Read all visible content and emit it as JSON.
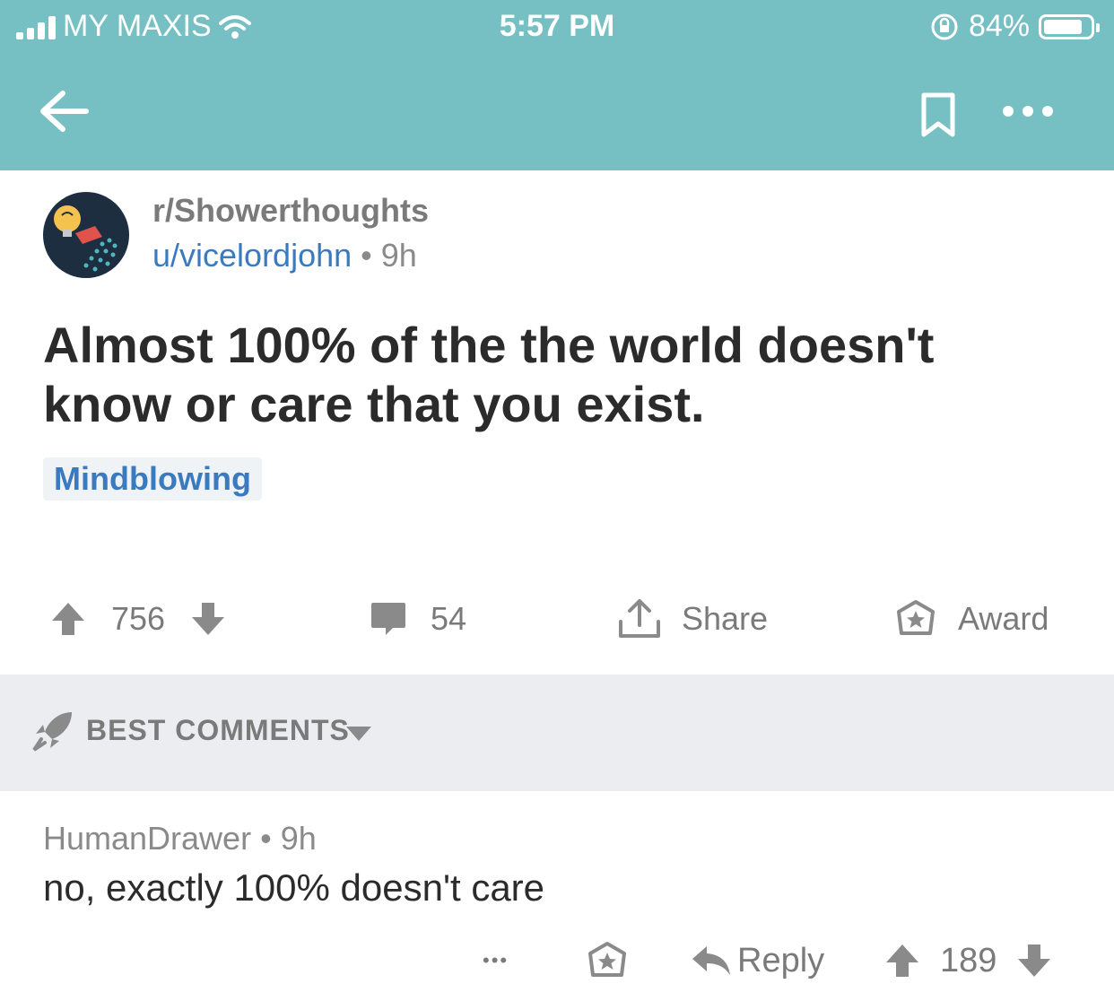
{
  "status_bar": {
    "carrier": "MY MAXIS",
    "time": "5:57 PM",
    "battery_percent": "84%",
    "battery_level": 0.84
  },
  "nav": {
    "back_icon": "arrow-left-icon",
    "bookmark_icon": "bookmark-icon",
    "more_icon": "more-horizontal-icon"
  },
  "post": {
    "subreddit": "r/Showerthoughts",
    "author": "u/vicelordjohn",
    "separator": "•",
    "age": "9h",
    "title": "Almost 100% of the the world doesn't know or care that you exist.",
    "flair": "Mindblowing"
  },
  "actions": {
    "votes": "756",
    "comments": "54",
    "share_label": "Share",
    "award_label": "Award"
  },
  "comments_sort": {
    "label": "BEST COMMENTS"
  },
  "comment": {
    "author": "HumanDrawer",
    "separator": "•",
    "age": "9h",
    "body": "no, exactly 100% doesn't care",
    "more": "•••",
    "reply_label": "Reply",
    "votes": "189"
  },
  "colors": {
    "header_bg": "#76c0c4",
    "link_blue": "#3a7bbf",
    "muted_gray": "#7a7a7a",
    "section_bg": "#ebedf0"
  }
}
